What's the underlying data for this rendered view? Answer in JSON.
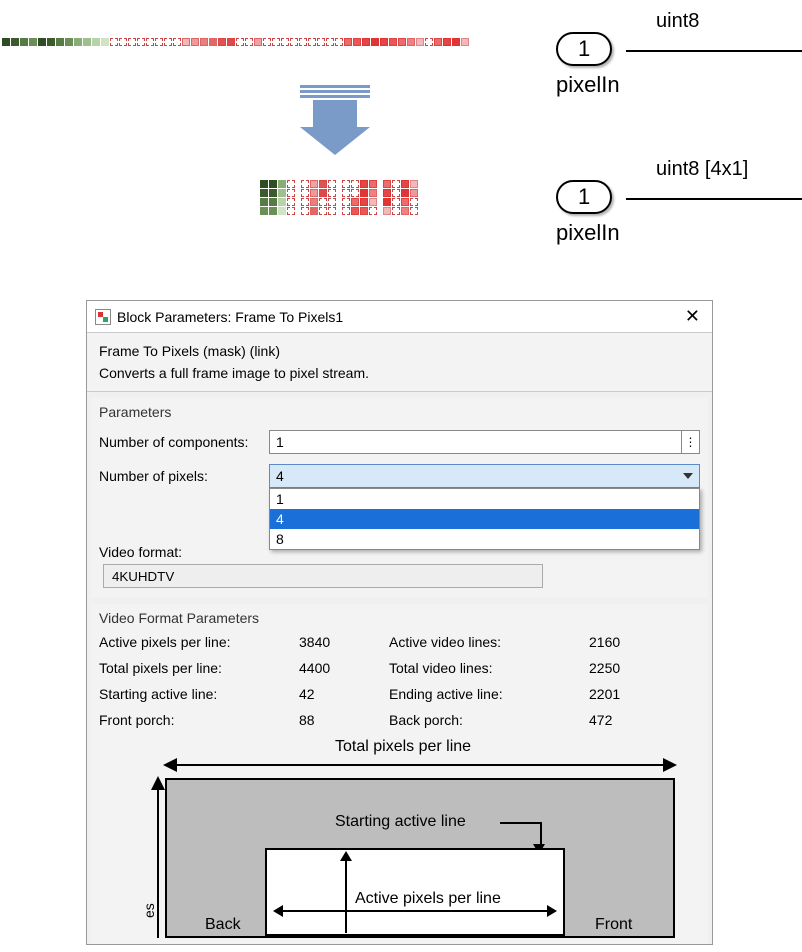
{
  "diagram": {
    "port1": {
      "num": "1",
      "type": "uint8",
      "name": "pixelIn"
    },
    "port2": {
      "num": "1",
      "type": "uint8 [4x1]",
      "name": "pixelIn"
    }
  },
  "dialog": {
    "title": "Block Parameters: Frame To Pixels1",
    "mask_title": "Frame To Pixels (mask) (link)",
    "mask_desc": "Converts a full frame image to pixel stream.",
    "params_label": "Parameters",
    "num_components_label": "Number of components:",
    "num_components_value": "1",
    "num_pixels_label": "Number of pixels:",
    "num_pixels_selected": "4",
    "num_pixels_options": [
      "1",
      "4",
      "8"
    ],
    "video_format_label": "Video format:",
    "video_format_value": "4KUHDTV",
    "vfp_label": "Video Format Parameters",
    "vfp": {
      "active_pixels_per_line_label": "Active pixels per line:",
      "active_pixels_per_line": "3840",
      "active_video_lines_label": "Active video lines:",
      "active_video_lines": "2160",
      "total_pixels_per_line_label": "Total pixels per line:",
      "total_pixels_per_line": "4400",
      "total_video_lines_label": "Total video lines:",
      "total_video_lines": "2250",
      "starting_active_line_label": "Starting active line:",
      "starting_active_line": "42",
      "ending_active_line_label": "Ending active line:",
      "ending_active_line": "2201",
      "front_porch_label": "Front porch:",
      "front_porch": "88",
      "back_porch_label": "Back porch:",
      "back_porch": "472"
    },
    "fd": {
      "total_pixels": "Total pixels per line",
      "starting_active_line": "Starting active line",
      "active_pixels": "Active pixels per line",
      "back": "Back",
      "front": "Front",
      "es": "es"
    }
  }
}
